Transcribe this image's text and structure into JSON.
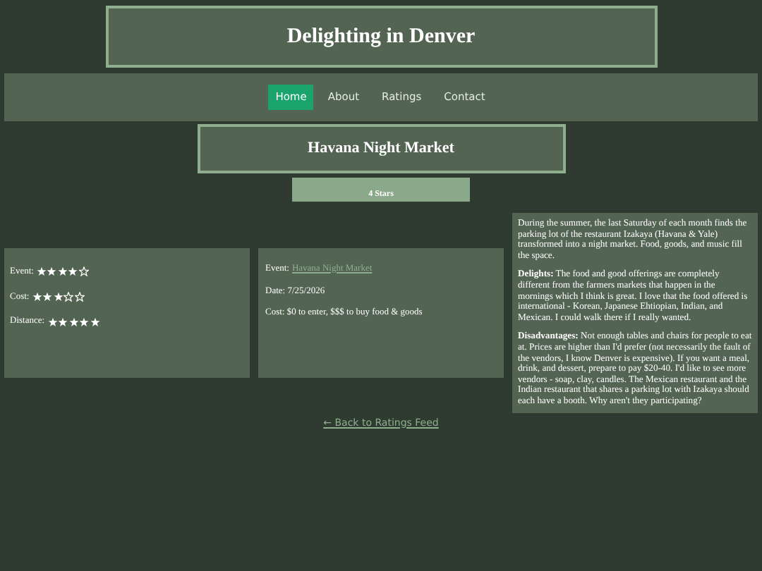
{
  "site_title": "Delighting in Denver",
  "nav": [
    {
      "label": "Home",
      "selected": true
    },
    {
      "label": "About",
      "selected": false
    },
    {
      "label": "Ratings",
      "selected": false
    },
    {
      "label": "Contact",
      "selected": false
    }
  ],
  "page_title": "Havana Night Market",
  "overall": "4 Stars",
  "ratings": [
    {
      "label": "Event:",
      "stars": 4
    },
    {
      "label": "Cost:",
      "stars": 3
    },
    {
      "label": "Distance:",
      "stars": 5
    }
  ],
  "details": {
    "event_label": "Event:",
    "event_link": "Havana Night Market",
    "date": "Date: 7/25/2026",
    "cost": "Cost: $0 to enter, $$$ to buy food & goods"
  },
  "review": [
    "During the summer, the last Saturday of each month finds the parking lot of the restaurant Izakaya (Havana & Yale) transformed into a night market. Food, goods, and music fill the space.",
    "**Delights:** The food and good offerings are completely different from the farmers markets that happen in the mornings which I think is great. I love that the food offered is international - Korean, Japanese Ehtiopian, Indian, and Mexican. I could walk there if I really wanted.",
    "**Disadvantages:** Not enough tables and chairs for people to eat at. Prices are higher than I'd prefer (not necessarily the fault of the vendors, I know Denver is expensive). If you want a meal, drink, and dessert, prepare to pay $20-40. I'd like to see more vendors - soap, clay, candles. The Mexican restaurant and the Indian restaurant that shares a parking lot with Izakaya should each have a booth. Why aren't they participating?"
  ],
  "back_link": "← Back to Ratings Feed"
}
